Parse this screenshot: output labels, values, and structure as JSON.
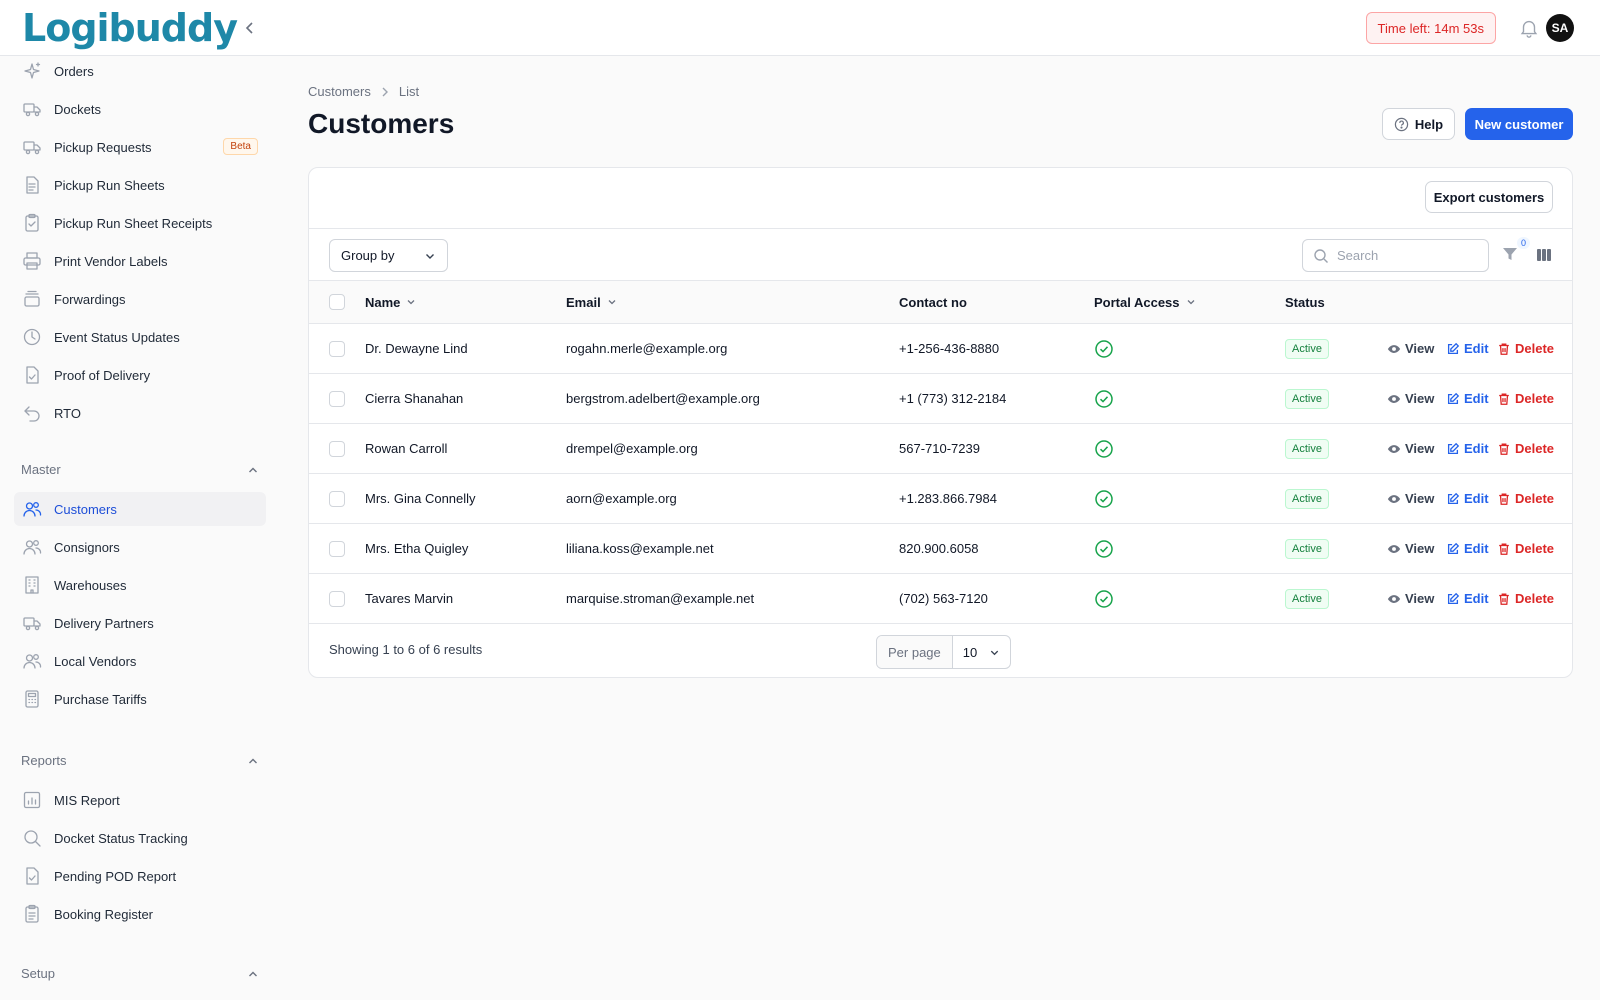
{
  "app": {
    "logo_text": "Logibuddy",
    "timer": "Time left: 14m 53s",
    "avatar_initials": "SA"
  },
  "sidebar": {
    "items": [
      {
        "label": "Orders",
        "icon": "sparkles-icon"
      },
      {
        "label": "Dockets",
        "icon": "truck-icon"
      },
      {
        "label": "Pickup Requests",
        "icon": "truck-icon",
        "badge": "Beta"
      },
      {
        "label": "Pickup Run Sheets",
        "icon": "document-icon"
      },
      {
        "label": "Pickup Run Sheet Receipts",
        "icon": "clipboard-check-icon"
      },
      {
        "label": "Print Vendor Labels",
        "icon": "printer-icon"
      },
      {
        "label": "Forwardings",
        "icon": "stack-icon"
      },
      {
        "label": "Event Status Updates",
        "icon": "clock-icon"
      },
      {
        "label": "Proof of Delivery",
        "icon": "document-check-icon"
      },
      {
        "label": "RTO",
        "icon": "return-arrow-icon"
      }
    ],
    "sections": [
      {
        "title": "Master",
        "items": [
          {
            "label": "Customers",
            "icon": "users-icon",
            "active": true
          },
          {
            "label": "Consignors",
            "icon": "users-icon"
          },
          {
            "label": "Warehouses",
            "icon": "building-icon"
          },
          {
            "label": "Delivery Partners",
            "icon": "truck-icon"
          },
          {
            "label": "Local Vendors",
            "icon": "users-icon"
          },
          {
            "label": "Purchase Tariffs",
            "icon": "calculator-icon"
          }
        ]
      },
      {
        "title": "Reports",
        "items": [
          {
            "label": "MIS Report",
            "icon": "chart-bar-icon"
          },
          {
            "label": "Docket Status Tracking",
            "icon": "search-icon"
          },
          {
            "label": "Pending POD Report",
            "icon": "document-check-icon"
          },
          {
            "label": "Booking Register",
            "icon": "clipboard-icon"
          }
        ]
      },
      {
        "title": "Setup",
        "items": []
      }
    ]
  },
  "breadcrumb": {
    "root": "Customers",
    "current": "List"
  },
  "page": {
    "title": "Customers",
    "help_label": "Help",
    "new_label": "New customer",
    "export_label": "Export customers"
  },
  "toolbar": {
    "group_by": "Group by",
    "search_placeholder": "Search",
    "filter_count": "0"
  },
  "table": {
    "headers": {
      "name": "Name",
      "email": "Email",
      "contact": "Contact no",
      "portal": "Portal Access",
      "status": "Status"
    },
    "actions": {
      "view": "View",
      "edit": "Edit",
      "delete": "Delete"
    },
    "rows": [
      {
        "name": "Dr. Dewayne Lind",
        "email": "rogahn.merle@example.org",
        "contact": "+1-256-436-8880",
        "portal_access": true,
        "status": "Active"
      },
      {
        "name": "Cierra Shanahan",
        "email": "bergstrom.adelbert@example.org",
        "contact": "+1 (773) 312-2184",
        "portal_access": true,
        "status": "Active"
      },
      {
        "name": "Rowan Carroll",
        "email": "drempel@example.org",
        "contact": "567-710-7239",
        "portal_access": true,
        "status": "Active"
      },
      {
        "name": "Mrs. Gina Connelly",
        "email": "aorn@example.org",
        "contact": "+1.283.866.7984",
        "portal_access": true,
        "status": "Active"
      },
      {
        "name": "Mrs. Etha Quigley",
        "email": "liliana.koss@example.net",
        "contact": "820.900.6058",
        "portal_access": true,
        "status": "Active"
      },
      {
        "name": "Tavares Marvin",
        "email": "marquise.stroman@example.net",
        "contact": "(702) 563-7120",
        "portal_access": true,
        "status": "Active"
      }
    ]
  },
  "pagination": {
    "summary": "Showing 1 to 6 of 6 results",
    "per_page_label": "Per page",
    "per_page_value": "10"
  },
  "colors": {
    "primary": "#2563eb",
    "danger": "#dc2626",
    "success": "#16a34a",
    "logo": "#1e88a8"
  }
}
